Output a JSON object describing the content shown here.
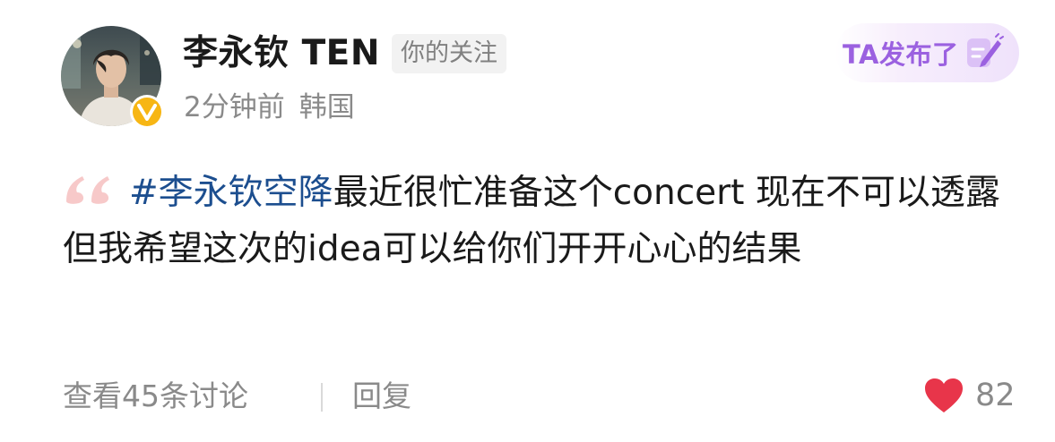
{
  "post": {
    "author": {
      "name": "李永钦 TEN",
      "follow_tag": "你的关注",
      "verified_icon": "v-badge-icon",
      "verified_color": "#f7b614"
    },
    "time": "2分钟前",
    "location": "韩国",
    "ta_published_label": "TA发布了",
    "content": {
      "hashtag": "#李永钦空降",
      "text": "最近很忙准备这个concert 现在不可以透露 但我希望这次的idea可以给你们开开心心的结果"
    },
    "footer": {
      "discussion": "查看45条讨论",
      "reply": "回复",
      "likes": "82"
    }
  },
  "colors": {
    "hashtag": "#1c4e8f",
    "like": "#e8354a",
    "ta_published": "#9b61e0",
    "secondary_text": "#8a8a8a"
  }
}
